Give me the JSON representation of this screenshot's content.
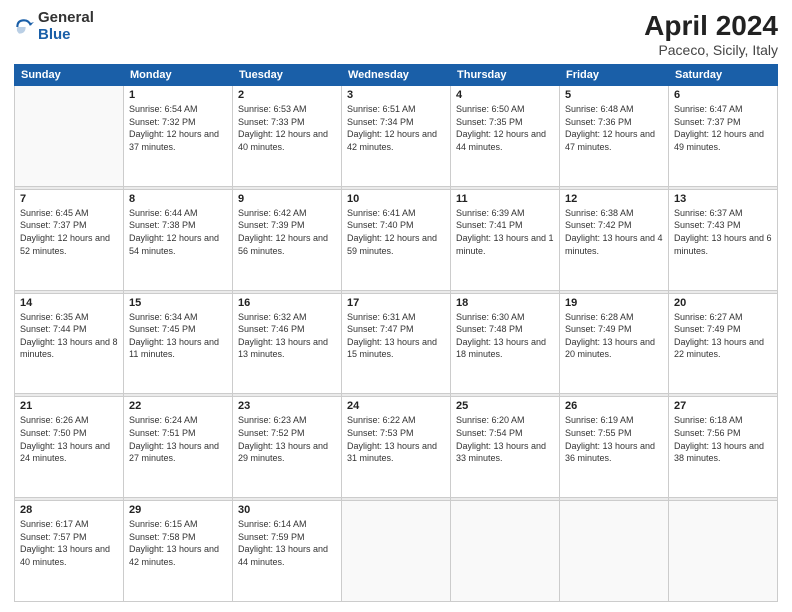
{
  "header": {
    "logo_general": "General",
    "logo_blue": "Blue",
    "title": "April 2024",
    "location": "Paceco, Sicily, Italy"
  },
  "weekdays": [
    "Sunday",
    "Monday",
    "Tuesday",
    "Wednesday",
    "Thursday",
    "Friday",
    "Saturday"
  ],
  "weeks": [
    [
      {
        "day": "",
        "empty": true
      },
      {
        "day": "1",
        "sunrise": "6:54 AM",
        "sunset": "7:32 PM",
        "daylight": "12 hours and 37 minutes."
      },
      {
        "day": "2",
        "sunrise": "6:53 AM",
        "sunset": "7:33 PM",
        "daylight": "12 hours and 40 minutes."
      },
      {
        "day": "3",
        "sunrise": "6:51 AM",
        "sunset": "7:34 PM",
        "daylight": "12 hours and 42 minutes."
      },
      {
        "day": "4",
        "sunrise": "6:50 AM",
        "sunset": "7:35 PM",
        "daylight": "12 hours and 44 minutes."
      },
      {
        "day": "5",
        "sunrise": "6:48 AM",
        "sunset": "7:36 PM",
        "daylight": "12 hours and 47 minutes."
      },
      {
        "day": "6",
        "sunrise": "6:47 AM",
        "sunset": "7:37 PM",
        "daylight": "12 hours and 49 minutes."
      }
    ],
    [
      {
        "day": "7",
        "sunrise": "6:45 AM",
        "sunset": "7:37 PM",
        "daylight": "12 hours and 52 minutes."
      },
      {
        "day": "8",
        "sunrise": "6:44 AM",
        "sunset": "7:38 PM",
        "daylight": "12 hours and 54 minutes."
      },
      {
        "day": "9",
        "sunrise": "6:42 AM",
        "sunset": "7:39 PM",
        "daylight": "12 hours and 56 minutes."
      },
      {
        "day": "10",
        "sunrise": "6:41 AM",
        "sunset": "7:40 PM",
        "daylight": "12 hours and 59 minutes."
      },
      {
        "day": "11",
        "sunrise": "6:39 AM",
        "sunset": "7:41 PM",
        "daylight": "13 hours and 1 minute."
      },
      {
        "day": "12",
        "sunrise": "6:38 AM",
        "sunset": "7:42 PM",
        "daylight": "13 hours and 4 minutes."
      },
      {
        "day": "13",
        "sunrise": "6:37 AM",
        "sunset": "7:43 PM",
        "daylight": "13 hours and 6 minutes."
      }
    ],
    [
      {
        "day": "14",
        "sunrise": "6:35 AM",
        "sunset": "7:44 PM",
        "daylight": "13 hours and 8 minutes."
      },
      {
        "day": "15",
        "sunrise": "6:34 AM",
        "sunset": "7:45 PM",
        "daylight": "13 hours and 11 minutes."
      },
      {
        "day": "16",
        "sunrise": "6:32 AM",
        "sunset": "7:46 PM",
        "daylight": "13 hours and 13 minutes."
      },
      {
        "day": "17",
        "sunrise": "6:31 AM",
        "sunset": "7:47 PM",
        "daylight": "13 hours and 15 minutes."
      },
      {
        "day": "18",
        "sunrise": "6:30 AM",
        "sunset": "7:48 PM",
        "daylight": "13 hours and 18 minutes."
      },
      {
        "day": "19",
        "sunrise": "6:28 AM",
        "sunset": "7:49 PM",
        "daylight": "13 hours and 20 minutes."
      },
      {
        "day": "20",
        "sunrise": "6:27 AM",
        "sunset": "7:49 PM",
        "daylight": "13 hours and 22 minutes."
      }
    ],
    [
      {
        "day": "21",
        "sunrise": "6:26 AM",
        "sunset": "7:50 PM",
        "daylight": "13 hours and 24 minutes."
      },
      {
        "day": "22",
        "sunrise": "6:24 AM",
        "sunset": "7:51 PM",
        "daylight": "13 hours and 27 minutes."
      },
      {
        "day": "23",
        "sunrise": "6:23 AM",
        "sunset": "7:52 PM",
        "daylight": "13 hours and 29 minutes."
      },
      {
        "day": "24",
        "sunrise": "6:22 AM",
        "sunset": "7:53 PM",
        "daylight": "13 hours and 31 minutes."
      },
      {
        "day": "25",
        "sunrise": "6:20 AM",
        "sunset": "7:54 PM",
        "daylight": "13 hours and 33 minutes."
      },
      {
        "day": "26",
        "sunrise": "6:19 AM",
        "sunset": "7:55 PM",
        "daylight": "13 hours and 36 minutes."
      },
      {
        "day": "27",
        "sunrise": "6:18 AM",
        "sunset": "7:56 PM",
        "daylight": "13 hours and 38 minutes."
      }
    ],
    [
      {
        "day": "28",
        "sunrise": "6:17 AM",
        "sunset": "7:57 PM",
        "daylight": "13 hours and 40 minutes."
      },
      {
        "day": "29",
        "sunrise": "6:15 AM",
        "sunset": "7:58 PM",
        "daylight": "13 hours and 42 minutes."
      },
      {
        "day": "30",
        "sunrise": "6:14 AM",
        "sunset": "7:59 PM",
        "daylight": "13 hours and 44 minutes."
      },
      {
        "day": "",
        "empty": true
      },
      {
        "day": "",
        "empty": true
      },
      {
        "day": "",
        "empty": true
      },
      {
        "day": "",
        "empty": true
      }
    ]
  ],
  "labels": {
    "sunrise": "Sunrise:",
    "sunset": "Sunset:",
    "daylight": "Daylight:"
  }
}
